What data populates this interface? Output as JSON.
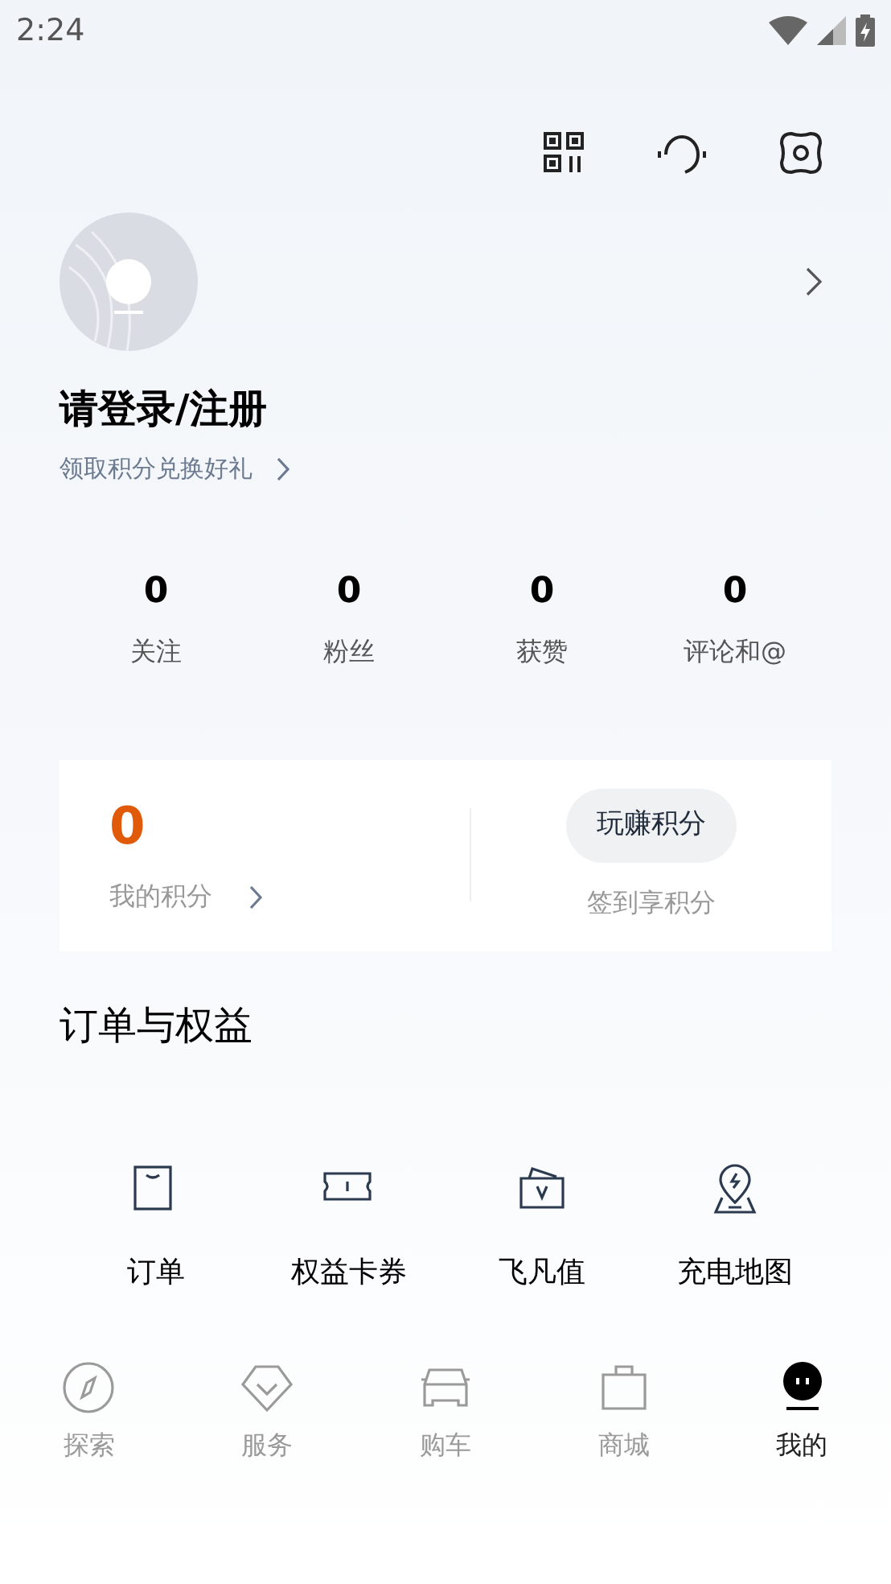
{
  "status_bar": {
    "time": "2:24"
  },
  "profile": {
    "login_prompt": "请登录/注册",
    "points_promo": "领取积分兑换好礼"
  },
  "stats": [
    {
      "value": "0",
      "label": "关注"
    },
    {
      "value": "0",
      "label": "粉丝"
    },
    {
      "value": "0",
      "label": "获赞"
    },
    {
      "value": "0",
      "label": "评论和@"
    }
  ],
  "points_card": {
    "points": "0",
    "points_label": "我的积分",
    "earn_button": "玩赚积分",
    "earn_hint": "签到享积分"
  },
  "orders_section": {
    "title": "订单与权益",
    "items": [
      {
        "kind": "bag",
        "label": "订单"
      },
      {
        "kind": "ticket",
        "label": "权益卡券"
      },
      {
        "kind": "wallet",
        "label": "飞凡值"
      },
      {
        "kind": "map",
        "label": "充电地图"
      }
    ]
  },
  "bottom_nav": [
    {
      "kind": "compass",
      "label": "探索",
      "selected": false
    },
    {
      "kind": "diamond",
      "label": "服务",
      "selected": false
    },
    {
      "kind": "car",
      "label": "购车",
      "selected": false
    },
    {
      "kind": "bag",
      "label": "商城",
      "selected": false
    },
    {
      "kind": "face",
      "label": "我的",
      "selected": true
    }
  ]
}
